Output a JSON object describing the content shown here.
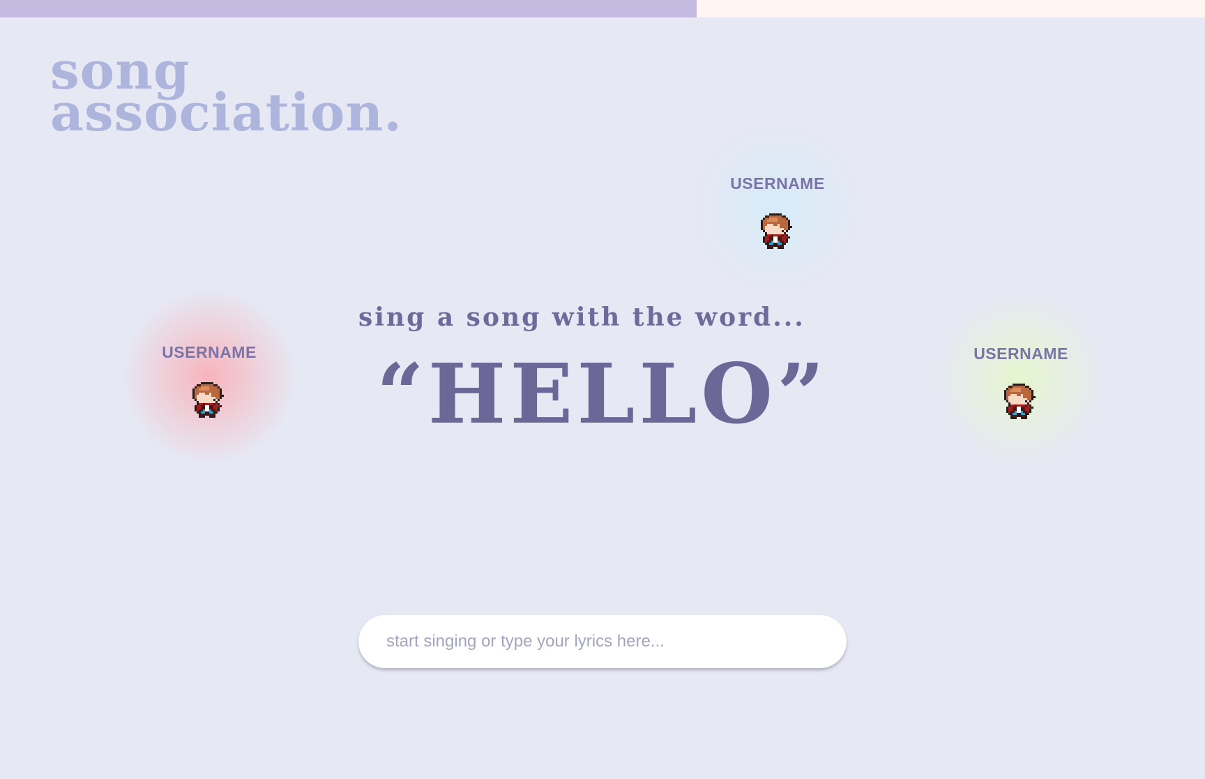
{
  "timer": {
    "progress": 0.578
  },
  "logo": {
    "line1": "song",
    "line2": "association."
  },
  "prompt": {
    "label": "sing a song with the word...",
    "word": "“HELLO”"
  },
  "players": [
    {
      "name": "USERNAME",
      "glow_color": "#f8b4bb"
    },
    {
      "name": "USERNAME",
      "glow_color": "#d6ecf8"
    },
    {
      "name": "USERNAME",
      "glow_color": "#e6f6cf"
    }
  ],
  "lyrics_input": {
    "placeholder": "start singing or type your lyrics here...",
    "value": ""
  },
  "colors": {
    "background": "#e6e8f4",
    "timer_fill": "#c5bbe0",
    "timer_track": "#fff6f3",
    "logo": "#adb5dd",
    "text": "#6b6898"
  }
}
